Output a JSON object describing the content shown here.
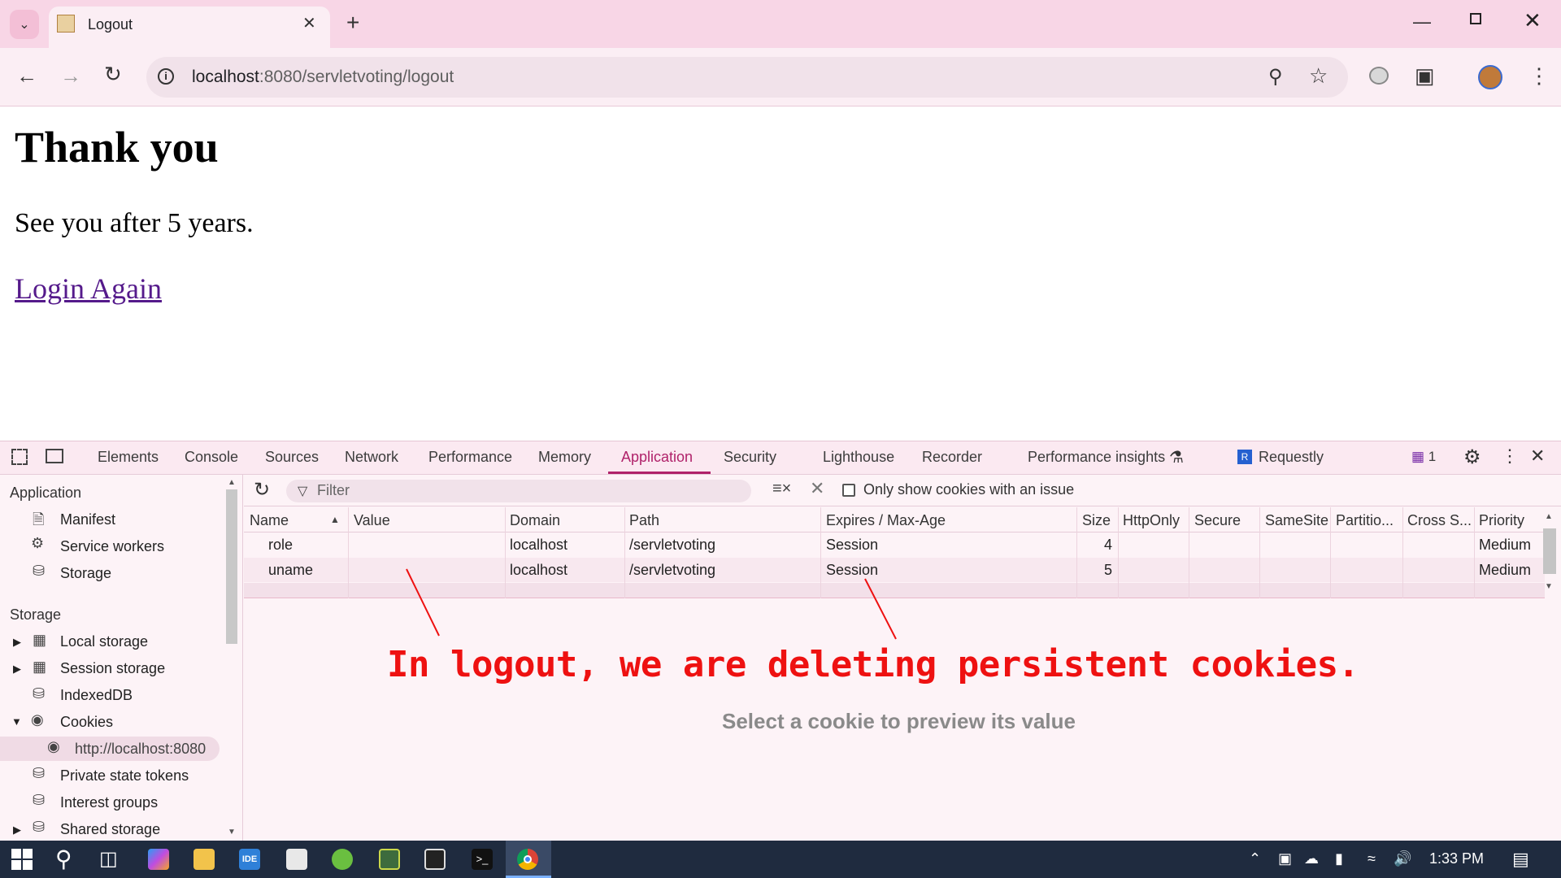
{
  "browser": {
    "tab_title": "Logout",
    "url_host": "localhost",
    "url_path": ":8080/servletvoting/logout",
    "icons": [
      "tab-search-icon",
      "favicon-icon",
      "close-icon",
      "plus-icon",
      "back-icon",
      "forward-icon",
      "reload-icon",
      "info-icon",
      "zoom-icon",
      "star-icon",
      "extension-icon",
      "puzzle-icon",
      "profile-avatar",
      "more-icon"
    ]
  },
  "page": {
    "title": "Thank you",
    "message": "See you after 5 years.",
    "link": "Login Again"
  },
  "devtools": {
    "tabs": [
      "Elements",
      "Console",
      "Sources",
      "Network",
      "Performance",
      "Memory",
      "Application",
      "Security",
      "Lighthouse",
      "Recorder",
      "Performance insights",
      "Requestly"
    ],
    "active_tab": "Application",
    "issues_count": "1",
    "sidebar": {
      "application_header": "Application",
      "application_items": [
        "Manifest",
        "Service workers",
        "Storage"
      ],
      "storage_header": "Storage",
      "storage_items": [
        "Local storage",
        "Session storage",
        "IndexedDB",
        "Cookies",
        "http://localhost:8080",
        "Private state tokens",
        "Interest groups",
        "Shared storage"
      ],
      "selected": "http://localhost:8080"
    },
    "cookies": {
      "filter_placeholder": "Filter",
      "only_issue_label": "Only show cookies with an issue",
      "columns": [
        "Name",
        "Value",
        "Domain",
        "Path",
        "Expires / Max-Age",
        "Size",
        "HttpOnly",
        "Secure",
        "SameSite",
        "Partitio...",
        "Cross S...",
        "Priority"
      ],
      "rows": [
        {
          "name": "role",
          "value": "",
          "domain": "localhost",
          "path": "/servletvoting",
          "expires": "Session",
          "size": "4",
          "httponly": "",
          "secure": "",
          "samesite": "",
          "partition": "",
          "cross": "",
          "priority": "Medium"
        },
        {
          "name": "uname",
          "value": "",
          "domain": "localhost",
          "path": "/servletvoting",
          "expires": "Session",
          "size": "5",
          "httponly": "",
          "secure": "",
          "samesite": "",
          "partition": "",
          "cross": "",
          "priority": "Medium"
        }
      ],
      "preview_message": "Select a cookie to preview its value"
    },
    "annotation": "In logout, we are deleting persistent cookies.",
    "annotation_color": "#ee1111"
  },
  "taskbar": {
    "time": "1:33 PM",
    "apps": [
      "windows-start",
      "search",
      "task-view",
      "copilot",
      "file-explorer",
      "intellij-idea",
      "notepad",
      "spring-tools",
      "eclipse",
      "pycharm",
      "terminal",
      "chrome"
    ]
  }
}
